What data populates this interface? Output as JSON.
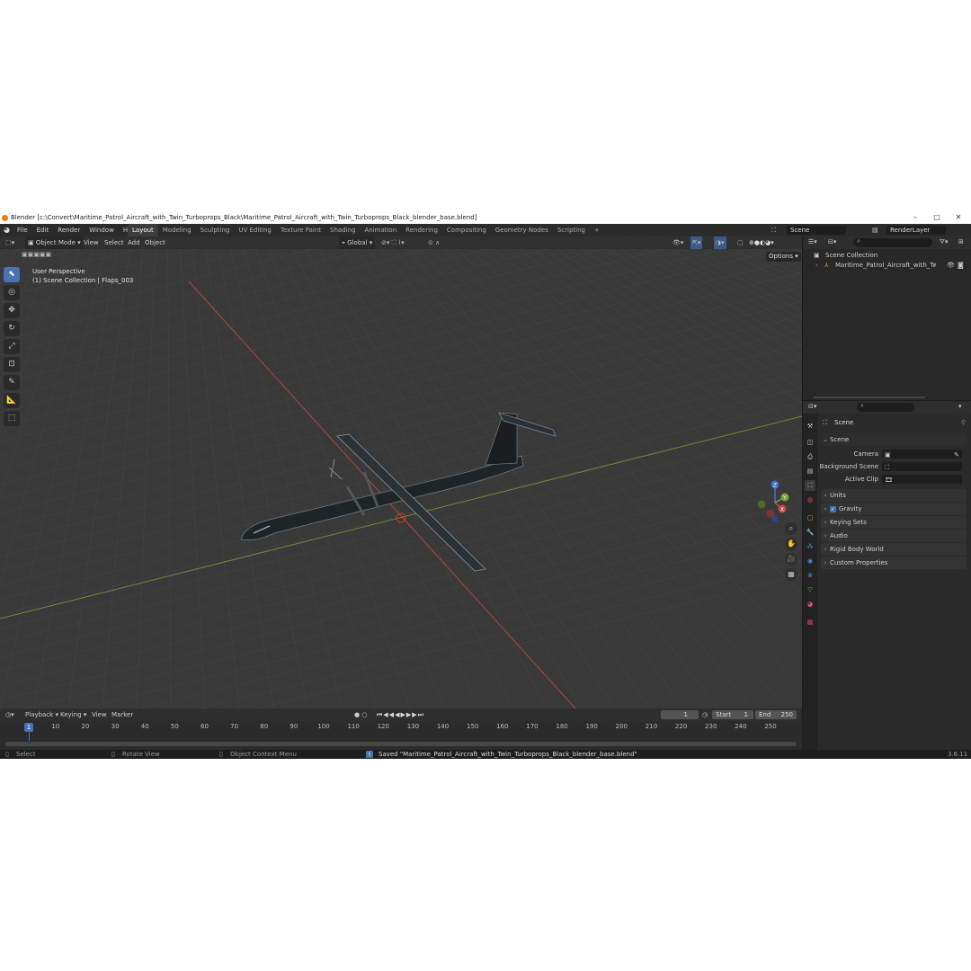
{
  "window": {
    "title": "Blender [c:\\Convert\\Maritime_Patrol_Aircraft_with_Twin_Turboprops_Black\\Maritime_Patrol_Aircraft_with_Twin_Turboprops_Black_blender_base.blend]",
    "minimize": "–",
    "maximize": "□",
    "close": "✕"
  },
  "menu": [
    "File",
    "Edit",
    "Render",
    "Window",
    "Help"
  ],
  "workspaces": [
    "Layout",
    "Modeling",
    "Sculpting",
    "UV Editing",
    "Texture Paint",
    "Shading",
    "Animation",
    "Rendering",
    "Compositing",
    "Geometry Nodes",
    "Scripting"
  ],
  "workspace_add": "+",
  "scene_field": "Scene",
  "view_layer_field": "RenderLayer",
  "viewport_header": {
    "mode": "Object Mode",
    "menus": [
      "View",
      "Select",
      "Add",
      "Object"
    ],
    "transform": "Global",
    "options": "Options"
  },
  "viewport": {
    "perspective": "User Perspective",
    "collection_info": "(1) Scene Collection | Flaps_003",
    "gizmo": {
      "x": "X",
      "y": "Y",
      "z": "Z"
    }
  },
  "timeline": {
    "menus": [
      "Playback",
      "Keying",
      "View",
      "Marker"
    ],
    "current_frame": "1",
    "start_label": "Start",
    "start": "1",
    "end_label": "End",
    "end": "250",
    "ticks": [
      "10",
      "20",
      "30",
      "40",
      "50",
      "60",
      "70",
      "80",
      "90",
      "100",
      "110",
      "120",
      "130",
      "140",
      "150",
      "160",
      "170",
      "180",
      "190",
      "200",
      "210",
      "220",
      "230",
      "240",
      "250"
    ],
    "ruler_frame": "1"
  },
  "outliner": {
    "root": "Scene Collection",
    "item": "Maritime_Patrol_Aircraft_with_Twin_Tur"
  },
  "properties": {
    "context": "Scene",
    "section": "Scene",
    "fields": [
      {
        "label": "Camera"
      },
      {
        "label": "Background Scene"
      },
      {
        "label": "Active Clip"
      }
    ],
    "panels": [
      "Units",
      "Gravity",
      "Keying Sets",
      "Audio",
      "Rigid Body World",
      "Custom Properties"
    ]
  },
  "status": {
    "select": "Select",
    "rotate": "Rotate View",
    "context_menu": "Object Context Menu",
    "message": "Saved \"Maritime_Patrol_Aircraft_with_Twin_Turboprops_Black_blender_base.blend\"",
    "version": "3.6.11"
  },
  "colors": {
    "accent": "#4772b3",
    "viewport_bg": "#393939",
    "x_axis": "#c84848",
    "y_axis": "#7ea03a"
  }
}
